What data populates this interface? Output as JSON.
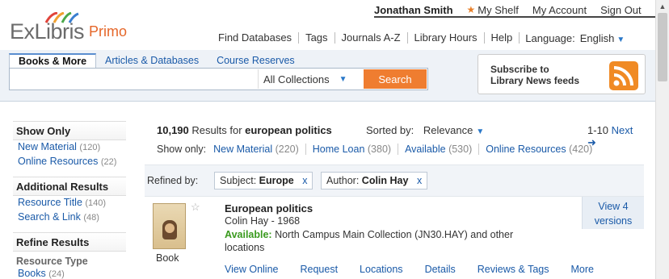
{
  "header": {
    "logo_text": "ExLibris",
    "logo_product": "Primo",
    "user_name": "Jonathan Smith",
    "links": [
      "My Shelf",
      "My Account",
      "Sign Out"
    ],
    "nav": [
      "Find Databases",
      "Tags",
      "Journals A-Z",
      "Library Hours",
      "Help"
    ],
    "language_label": "Language:",
    "language_value": "English"
  },
  "search": {
    "tabs": [
      "Books & More",
      "Articles & Databases",
      "Course Reserves"
    ],
    "query": "",
    "scope": "All Collections",
    "button_label": "Search"
  },
  "subscribe": {
    "line1": "Subscribe to",
    "line2": "Library News feeds"
  },
  "sidebar": {
    "show_only": {
      "heading": "Show Only",
      "items": [
        {
          "label": "New Material",
          "count": "(120)"
        },
        {
          "label": "Online Resources",
          "count": "(22)"
        }
      ]
    },
    "additional": {
      "heading": "Additional Results",
      "items": [
        {
          "label": "Resource Title",
          "count": "(140)"
        },
        {
          "label": "Search & Link",
          "count": "(48)"
        }
      ]
    },
    "refine": {
      "heading": "Refine Results",
      "subheading": "Resource Type",
      "items": [
        {
          "label": "Books",
          "count": "(24)"
        }
      ]
    }
  },
  "results": {
    "count": "10,190",
    "count_text": "Results for",
    "query": "european politics",
    "sort_label": "Sorted by:",
    "sort_value": "Relevance",
    "range": "1-10",
    "next_label": "Next",
    "show_only_label": "Show only:",
    "show_only": [
      {
        "label": "New Material",
        "count": "(220)"
      },
      {
        "label": "Home Loan",
        "count": "(380)"
      },
      {
        "label": "Available",
        "count": "(530)"
      },
      {
        "label": "Online Resources",
        "count": "(420)"
      }
    ],
    "refined_by_label": "Refined by:",
    "filters": [
      {
        "field": "Subject:",
        "value": "Europe"
      },
      {
        "field": "Author:",
        "value": "Colin Hay"
      }
    ]
  },
  "item": {
    "title": "European politics",
    "author_date": "Colin Hay - 1968",
    "status": "Available:",
    "location": "North Campus Main Collection (JN30.HAY) and other locations",
    "type": "Book",
    "versions_line1": "View 4",
    "versions_line2": "versions",
    "actions": [
      "View Online",
      "Request",
      "Locations",
      "Details",
      "Reviews & Tags",
      "More"
    ]
  },
  "colors": {
    "accent": "#ef7d30",
    "link": "#1a5aa8",
    "available": "#3a9a1e"
  }
}
